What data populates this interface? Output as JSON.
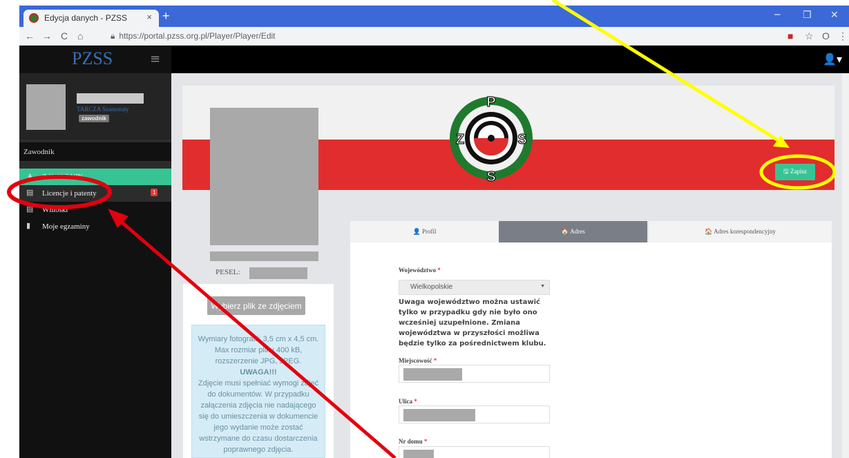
{
  "browser": {
    "tab_title": "Edycja danych - PZSS",
    "tab_close": "×",
    "new_tab": "+",
    "url": "https://portal.pzss.org.pl/Player/Player/Edit",
    "minimize": "─",
    "restore": "❐",
    "close": "✕",
    "back": "←",
    "forward": "→",
    "reload": "C",
    "home": "⌂",
    "lock": "🔒",
    "star": "☆",
    "menu": "⋮",
    "ext": "O"
  },
  "sidebar": {
    "brand": "PZSS",
    "hamburger": "≡",
    "club": "TARCZA Szamotuły",
    "role": "zawodnik",
    "section_label": "Zawodnik",
    "items": [
      {
        "label": "ZAWODNIK",
        "icon": "user-icon"
      },
      {
        "label": "Licencje i patenty",
        "icon": "id-card-icon",
        "badge": "1"
      },
      {
        "label": "Wnioski",
        "icon": "form-icon"
      },
      {
        "label": "Moje egzaminy",
        "icon": "book-icon"
      }
    ]
  },
  "topbar": {
    "user_icon": "👤▾"
  },
  "header": {
    "save_label": "🖫 Zapisz"
  },
  "emblem_letters": {
    "top": "P",
    "left": "Z",
    "right": "S",
    "bottom": "S"
  },
  "profile": {
    "pesel_label": "PESEL:",
    "upload_button": "Wybierz plik ze zdjęciem",
    "info_line1": "Wymiary fotografii: 3,5 cm x 4,5 cm. Max rozmiar pliku 400 kB, rozszerzenie JPG, JPEG.",
    "info_warn": "UWAGA!!!",
    "info_line2": "Zdjęcie musi spełniać wymogi zdjęć do dokumentów. W przypadku załączenia zdjęcia nie nadającego się do umieszczenia w dokumencie jego wydanie może zostać wstrzymane do czasu dostarczenia poprawnego zdjęcia."
  },
  "tabs": [
    {
      "label": "👤 Profil",
      "active": false
    },
    {
      "label": "🏠 Adres",
      "active": true
    },
    {
      "label": "🏠 Adres korespondencyjny",
      "active": false
    }
  ],
  "form": {
    "province_label": "Województwo",
    "province_value": "Wielkopolskie",
    "province_note": "Uwaga województwo można ustawić tylko w przypadku gdy nie było ono wcześniej uzupełnione. Zmiana województwa w przyszłości możliwa będzie tylko za pośrednictwem klubu.",
    "city_label": "Miejscowość",
    "street_label": "Ulica",
    "house_label": "Nr domu",
    "required_mark": "*"
  },
  "colors": {
    "accent": "#37c495",
    "brand_blue": "#3a6fb0",
    "annotation_red": "#e3000f",
    "annotation_yellow": "#ffff00"
  }
}
